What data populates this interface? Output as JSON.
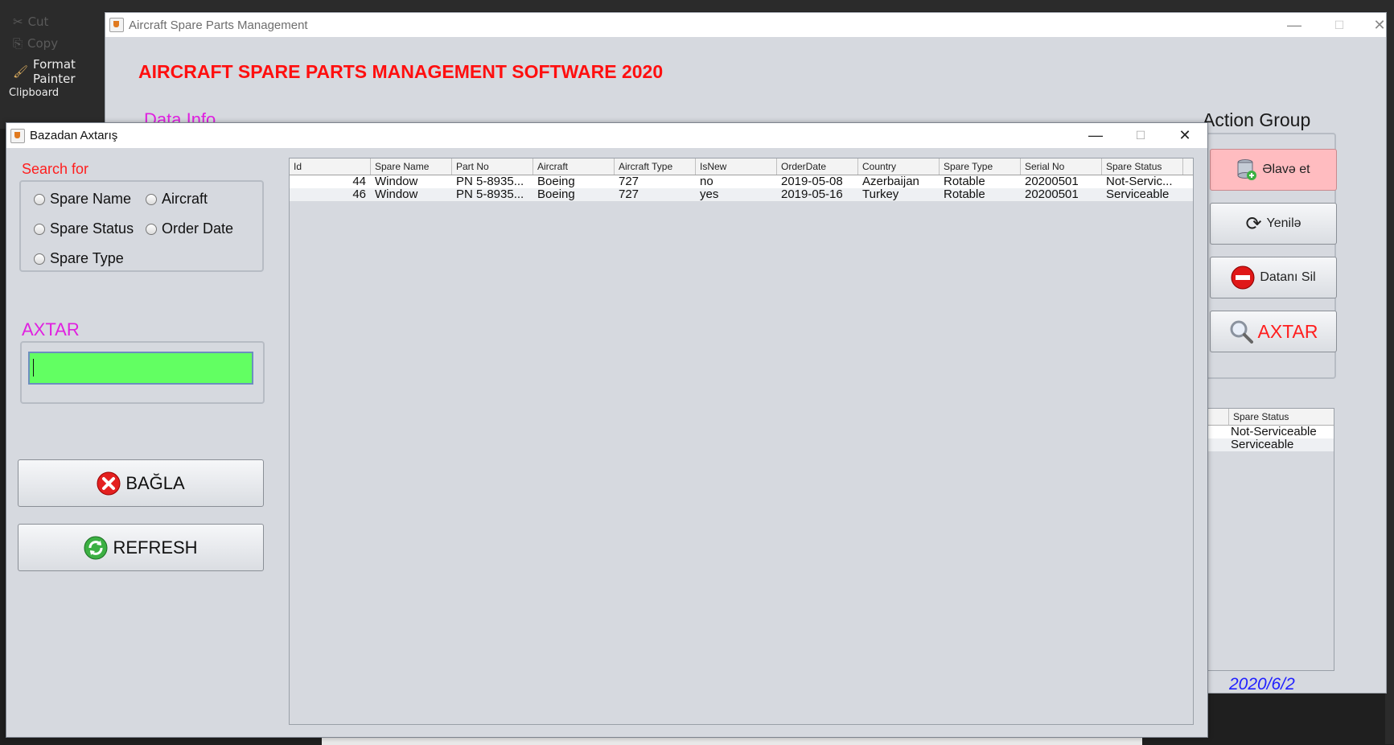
{
  "background_app": {
    "clipboard_items": [
      {
        "label": "Cut",
        "icon": "scissors-icon"
      },
      {
        "label": "Copy",
        "icon": "copy-icon"
      },
      {
        "label": "Format Painter",
        "icon": "paintbrush-icon"
      }
    ],
    "clipboard_group": "Clipboard"
  },
  "main_window": {
    "title": "Aircraft Spare Parts Management",
    "heading": "AIRCRAFT SPARE PARTS MANAGEMENT SOFTWARE 2020",
    "data_info_label": "Data Info",
    "action_group_label": "Action Group",
    "actions": {
      "add": "Əlavə et",
      "refresh": "Yenilə",
      "delete": "Datanı Sil",
      "search": "AXTAR"
    },
    "side_table": {
      "header": "Spare Status",
      "rows": [
        "Not-Serviceable",
        "Serviceable"
      ]
    },
    "date": "2020/6/2"
  },
  "dialog": {
    "title": "Bazadan Axtarış",
    "search_for_label": "Search for",
    "radios": {
      "spare_name": "Spare Name",
      "aircraft": "Aircraft",
      "spare_status": "Spare Status",
      "order_date": "Order Date",
      "spare_type": "Spare Type"
    },
    "axtar_label": "AXTAR",
    "search_value": "",
    "close_button": "BAĞLA",
    "refresh_button": "REFRESH",
    "table": {
      "columns": [
        "Id",
        "Spare Name",
        "Part No",
        "Aircraft",
        "Aircraft Type",
        "IsNew",
        "OrderDate",
        "Country",
        "Spare Type",
        "Serial No",
        "Spare Status"
      ],
      "rows": [
        [
          "44",
          "Window",
          "PN 5-8935...",
          "Boeing",
          "727",
          "no",
          "2019-05-08",
          "Azerbaijan",
          "Rotable",
          "20200501",
          "Not-Servic..."
        ],
        [
          "46",
          "Window",
          "PN 5-8935...",
          "Boeing",
          "727",
          "yes",
          "2019-05-16",
          "Turkey",
          "Rotable",
          "20200501",
          "Serviceable"
        ]
      ]
    }
  },
  "colors": {
    "heading_red": "#ff0f0f",
    "magenta_label": "#e020e0",
    "input_green": "#62ff62",
    "add_button_pink": "#ffbcc0",
    "date_blue": "#2020ff"
  }
}
